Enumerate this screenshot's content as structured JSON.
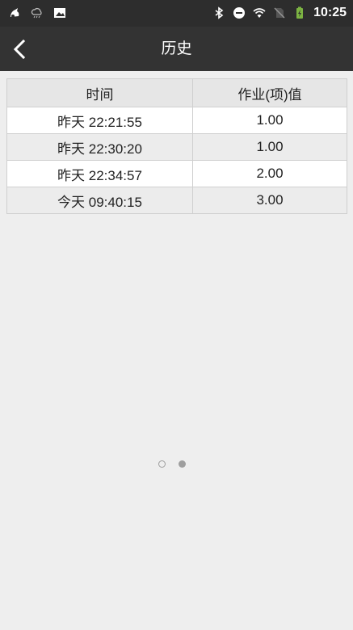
{
  "status_bar": {
    "time": "10:25",
    "left_icons": [
      "app-notification-icon",
      "weather-icon",
      "image-notification-icon"
    ],
    "right_icons": [
      "bluetooth-icon",
      "do-not-disturb-icon",
      "wifi-icon",
      "no-sim-icon",
      "battery-charging-icon"
    ],
    "battery_color": "#7cb342"
  },
  "app_bar": {
    "title": "历史",
    "back_icon": "chevron-left-icon"
  },
  "table": {
    "headers": [
      "时间",
      "作业(项)值"
    ],
    "rows": [
      {
        "time": "昨天 22:21:55",
        "value": "1.00"
      },
      {
        "time": "昨天 22:30:20",
        "value": "1.00"
      },
      {
        "time": "昨天 22:34:57",
        "value": "2.00"
      },
      {
        "time": "今天 09:40:15",
        "value": "3.00"
      }
    ]
  },
  "pager": {
    "page_count": 2,
    "current_page": 2
  }
}
